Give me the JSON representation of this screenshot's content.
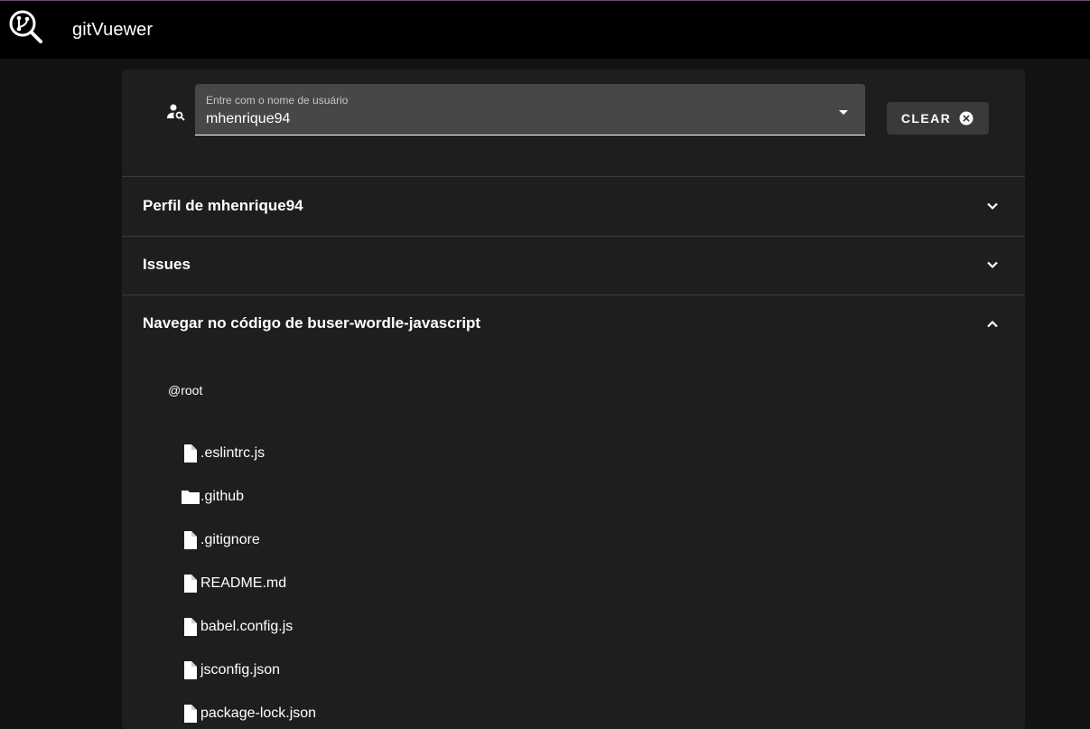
{
  "app": {
    "title": "gitVuewer",
    "logo_icon": "git-search-logo-icon"
  },
  "search": {
    "label": "Entre com o nome de usuário",
    "value": "mhenrique94",
    "icon": "account-search-icon"
  },
  "clear_button": {
    "label": "CLEAR",
    "icon": "close-circle-icon"
  },
  "panels": [
    {
      "title": "Perfil de mhenrique94",
      "expanded": false
    },
    {
      "title": "Issues",
      "expanded": false
    },
    {
      "title": "Navegar no código de buser-wordle-javascript",
      "expanded": true
    }
  ],
  "tree": {
    "root": "@root",
    "items": [
      {
        "name": ".eslintrc.js",
        "type": "file"
      },
      {
        "name": ".github",
        "type": "folder"
      },
      {
        "name": ".gitignore",
        "type": "file"
      },
      {
        "name": "README.md",
        "type": "file"
      },
      {
        "name": "babel.config.js",
        "type": "file"
      },
      {
        "name": "jsconfig.json",
        "type": "file"
      },
      {
        "name": "package-lock.json",
        "type": "file"
      }
    ]
  },
  "colors": {
    "appbar": "#000000",
    "background": "#121212",
    "card": "#1e1e1e",
    "field": "#474747",
    "button": "#3a3a3a"
  }
}
